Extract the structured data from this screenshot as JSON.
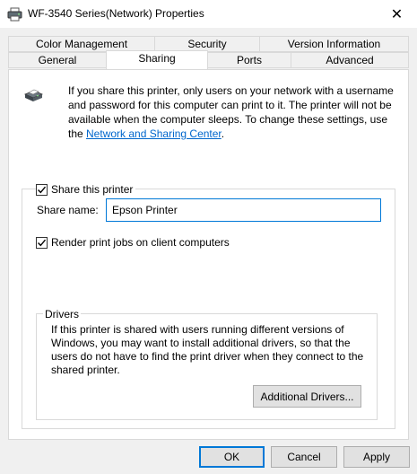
{
  "window": {
    "title": "WF-3540 Series(Network) Properties",
    "close_glyph": "✕"
  },
  "tabs": {
    "row_back": [
      "Color Management",
      "Security",
      "Version Information"
    ],
    "row_front": [
      "General",
      "Sharing",
      "Ports",
      "Advanced"
    ],
    "active": "Sharing"
  },
  "sharing": {
    "info_text": "If you share this printer, only users on your network with a username and password for this computer can print to it. The printer will not be available when the computer sleeps. To change these settings, use the ",
    "info_link": "Network and Sharing Center",
    "info_end": ".",
    "share_checkbox_label": "Share this printer",
    "share_checked": true,
    "share_name_label": "Share name:",
    "share_name_value": "Epson Printer",
    "render_checkbox_label": "Render print jobs on client computers",
    "render_checked": true
  },
  "drivers": {
    "legend": "Drivers",
    "text": "If this printer is shared with users running different versions of Windows, you may want to install additional drivers, so that the users do not have to find the print driver when they connect to the shared printer.",
    "button_label": "Additional Drivers..."
  },
  "buttons": {
    "ok": "OK",
    "cancel": "Cancel",
    "apply": "Apply"
  },
  "icons": {
    "title": "printer-icon",
    "info": "printer-share-icon",
    "close": "close-icon",
    "check": "checkmark-icon"
  },
  "colors": {
    "accent": "#0078d7",
    "link": "#0066cc",
    "dialog_bg": "#f0f0f0",
    "panel_bg": "#ffffff"
  }
}
